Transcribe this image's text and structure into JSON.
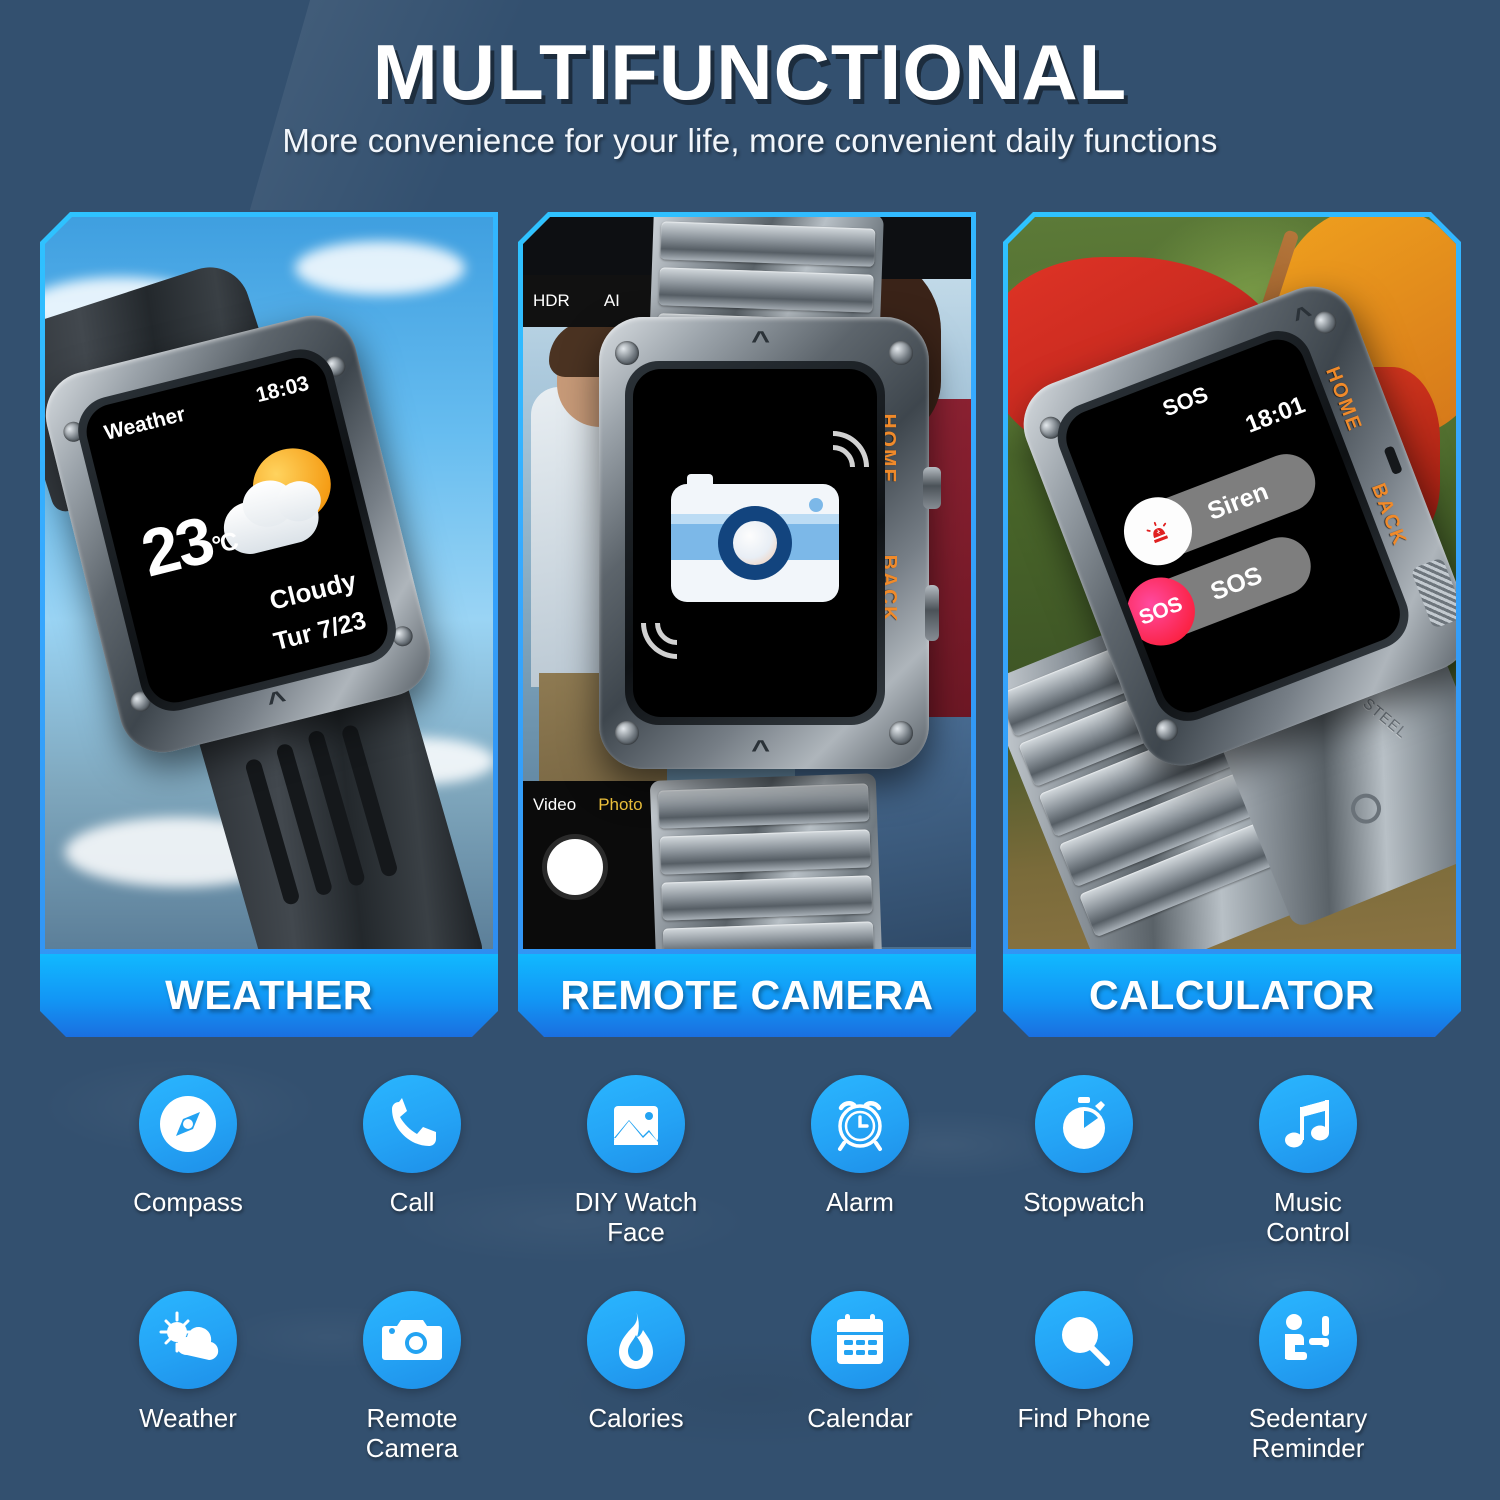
{
  "header": {
    "title": "MULTIFUNCTIONAL",
    "subtitle": "More convenience for your life, more convenient daily functions"
  },
  "colors": {
    "accent_cyan": "#2ab6ff",
    "accent_blue": "#1a6fe0",
    "background": "#33506f",
    "side_button_orange": "#f08a2a",
    "sos_pink": "#fb1f3d"
  },
  "panels": [
    {
      "caption": "WEATHER",
      "scene": "sky-clouds",
      "watch_screen": {
        "app_title": "Weather",
        "time": "18:03",
        "temperature": "23",
        "unit": "°C",
        "condition": "Cloudy",
        "date": "Tur 7/23",
        "icon": "sun-behind-cloud-icon"
      },
      "band_type": "rubber"
    },
    {
      "caption": "REMOTE CAMERA",
      "scene": "couple-photo",
      "phone_ui": {
        "top_modes": [
          "HDR",
          "AI"
        ],
        "shutter_icon": "shutter-button",
        "tabs": [
          {
            "label": "Video",
            "active": false
          },
          {
            "label": "Photo",
            "active": true
          }
        ]
      },
      "watch_screen": {
        "icon": "camera-icon",
        "signal": "wireless-waves"
      },
      "side_labels": [
        "HOME",
        "BACK"
      ],
      "band_type": "steel"
    },
    {
      "caption": "CALCULATOR",
      "scene": "outdoor-climbing",
      "watch_screen": {
        "app_title": "SOS",
        "time": "18:01",
        "rows": [
          {
            "label": "Siren",
            "badge": "siren-icon",
            "badge_style": "white"
          },
          {
            "label": "SOS",
            "badge": "SOS",
            "badge_style": "pink"
          }
        ]
      },
      "side_labels": [
        "HOME",
        "BACK"
      ],
      "band_type": "steel",
      "band_engraving": "STAINLESS STEEL"
    }
  ],
  "features": {
    "row1": [
      {
        "label": "Compass",
        "icon": "compass-icon"
      },
      {
        "label": "Call",
        "icon": "phone-icon"
      },
      {
        "label": "DIY Watch\nFace",
        "icon": "image-icon"
      },
      {
        "label": "Alarm",
        "icon": "alarm-clock-icon"
      },
      {
        "label": "Stopwatch",
        "icon": "stopwatch-icon"
      },
      {
        "label": "Music\nControl",
        "icon": "music-note-icon"
      }
    ],
    "row2": [
      {
        "label": "Weather",
        "icon": "sun-cloud-icon"
      },
      {
        "label": "Remote\nCamera",
        "icon": "camera-icon"
      },
      {
        "label": "Calories",
        "icon": "flame-icon"
      },
      {
        "label": "Calendar",
        "icon": "calendar-icon"
      },
      {
        "label": "Find Phone",
        "icon": "magnifier-icon"
      },
      {
        "label": "Sedentary\nReminder",
        "icon": "sedentary-person-icon"
      }
    ]
  }
}
